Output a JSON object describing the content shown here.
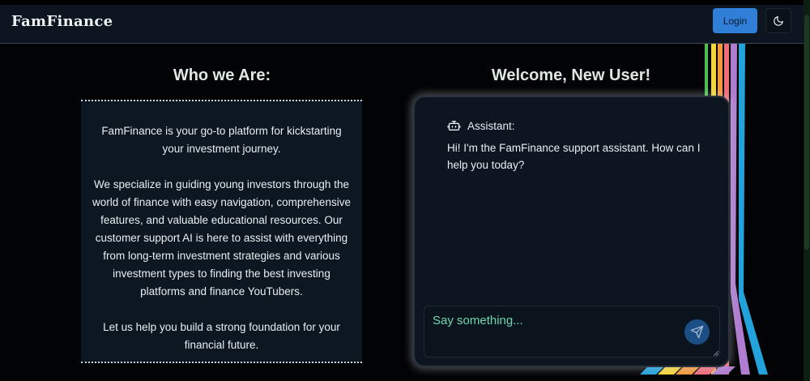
{
  "app": {
    "brand": "FamFinance"
  },
  "header": {
    "login_label": "Login",
    "theme_icon": "moon-icon"
  },
  "about": {
    "heading": "Who we Are:",
    "paragraphs": [
      "FamFinance is your go-to platform for kickstarting your investment journey.",
      "We specialize in guiding young investors through the world of finance with easy navigation, comprehensive features, and valuable educational resources. Our customer support AI is here to assist with everything from long-term investment strategies and various investment types to finding the best investing platforms and finance YouTubers.",
      "Let us help you build a strong foundation for your financial future."
    ]
  },
  "chat": {
    "heading": "Welcome, New User!",
    "sender": "Assistant:",
    "sender_icon": "robot-icon",
    "message": "Hi! I'm the FamFinance support assistant. How can I help you today?",
    "input_placeholder": "Say something...",
    "input_value": "",
    "send_icon": "send-icon"
  },
  "colors": {
    "accent": "#2f7fd8",
    "background": "#020304",
    "panel": "#0d1620",
    "placeholder": "#6fd6b0",
    "stripes": [
      "#22a3dc",
      "#b07dd0",
      "#f06c7a",
      "#f59a3b",
      "#f4d63a",
      "#4cc04e"
    ]
  }
}
